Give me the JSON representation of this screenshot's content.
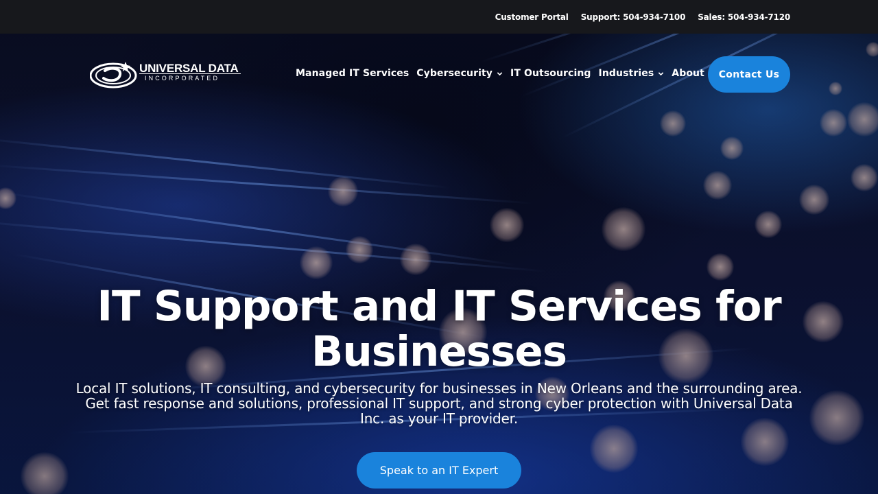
{
  "topbar": {
    "customer_portal": "Customer Portal",
    "support": "Support: 504-934-7100",
    "sales": "Sales: 504-934-7120"
  },
  "logo": {
    "name": "UNIVERSAL DATA",
    "tagline": "INCORPORATED"
  },
  "nav": {
    "items": [
      {
        "label": "Managed IT Services",
        "dropdown": false
      },
      {
        "label": "Cybersecurity",
        "dropdown": true
      },
      {
        "label": "IT Outsourcing",
        "dropdown": false
      },
      {
        "label": "Industries",
        "dropdown": true
      },
      {
        "label": "About",
        "dropdown": true
      }
    ],
    "contact_label": "Contact Us"
  },
  "hero": {
    "headline": "IT Support and IT Services for Businesses",
    "subtext": "Local IT solutions, IT consulting, and cybersecurity for businesses in New Orleans and the surrounding area. Get fast response and solutions, professional IT support, and strong cyber protection with Universal Data Inc. as your IT provider.",
    "cta_label": "Speak to an IT Expert"
  },
  "colors": {
    "accent": "#1a83dc",
    "topbar_bg": "#17181c",
    "text": "#ffffff"
  }
}
